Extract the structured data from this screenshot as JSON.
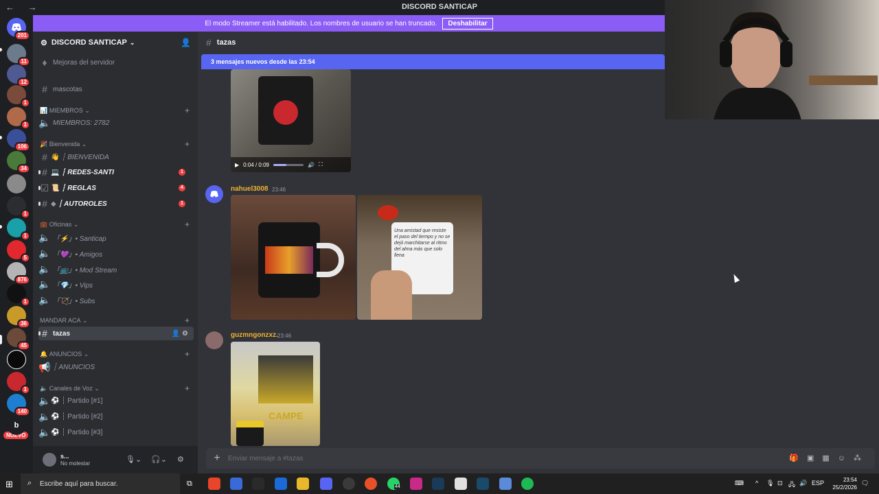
{
  "titlebar": {
    "title": "DISCORD SANTICAP",
    "nav": "← →"
  },
  "banner": {
    "text": "El modo Streamer está habilitado. Los nombres de usuario se han truncado.",
    "button": "Deshabilitar"
  },
  "rail": {
    "badges": [
      "201",
      "11",
      "12",
      "1",
      "1",
      "106",
      "34",
      "1",
      "1",
      "5",
      "876",
      "1",
      "36",
      "45",
      "1",
      "140"
    ],
    "nuevo": "NUEVO",
    "letter_server": "b"
  },
  "server": {
    "name": "DISCORD SANTICAP"
  },
  "sidebar": {
    "boost": "Mejoras del servidor",
    "mascotas": "mascotas",
    "cat_miembros": "MIEMBROS",
    "miembros": "MIEMBROS: 2782",
    "cat_bienvenida": "Bienvenida",
    "bienvenida": "┆ BIENVENIDA",
    "redes": "┆ REDES-SANTI",
    "reglas": "┆ REGLAS",
    "autoroles": "┆ AUTOROLES",
    "redes_badge": "1",
    "reglas_badge": "4",
    "autoroles_badge": "1",
    "cat_oficinas": "Oficinas",
    "v_santicap": "「⚡」• Santicap",
    "v_amigos": "「💜」• Amigos",
    "v_mod": "「📺」• Mod Stream",
    "v_vips": "「💎」• Vips",
    "v_subs": "「🏹」• Subs",
    "cat_mandar": "MANDAR ACA",
    "tazas": "tazas",
    "cat_anuncios": "ANUNCIOS",
    "anuncios": "┆ ANUNCIOS",
    "cat_voz": "Canales de Voz",
    "p1": "┆ Partido [#1]",
    "p2": "┆ Partido [#2]",
    "p3": "┆ Partido [#3]"
  },
  "user": {
    "name": "s...",
    "status": "No molestar"
  },
  "channel": {
    "name": "tazas",
    "new_messages": "3 mensajes nuevos desde las 23:54"
  },
  "video": {
    "time": "0:04 / 0:09",
    "progress": 0.44
  },
  "messages": [
    {
      "author": "nahuel3008",
      "time": "23:46"
    },
    {
      "author": "guzmngonzxz.",
      "time": "23:46"
    }
  ],
  "mug_text": "Una amistad que resiste el paso del tiempo y no se dejó marchitarse al ritmo del alma más que solo llena",
  "poster_text": "CAMPE",
  "composer": {
    "placeholder": "Enviar mensaje a #tazas"
  },
  "taskbar": {
    "search": "Escribe aquí para buscar.",
    "whatsapp_badge": "44",
    "lang": "ESP",
    "time": "23:54",
    "date": "25/2/2026"
  },
  "colors": {
    "blurple": "#5865f2",
    "streamer": "#8c5cf6",
    "author": "#f0b232",
    "badge": "#f23f43"
  }
}
